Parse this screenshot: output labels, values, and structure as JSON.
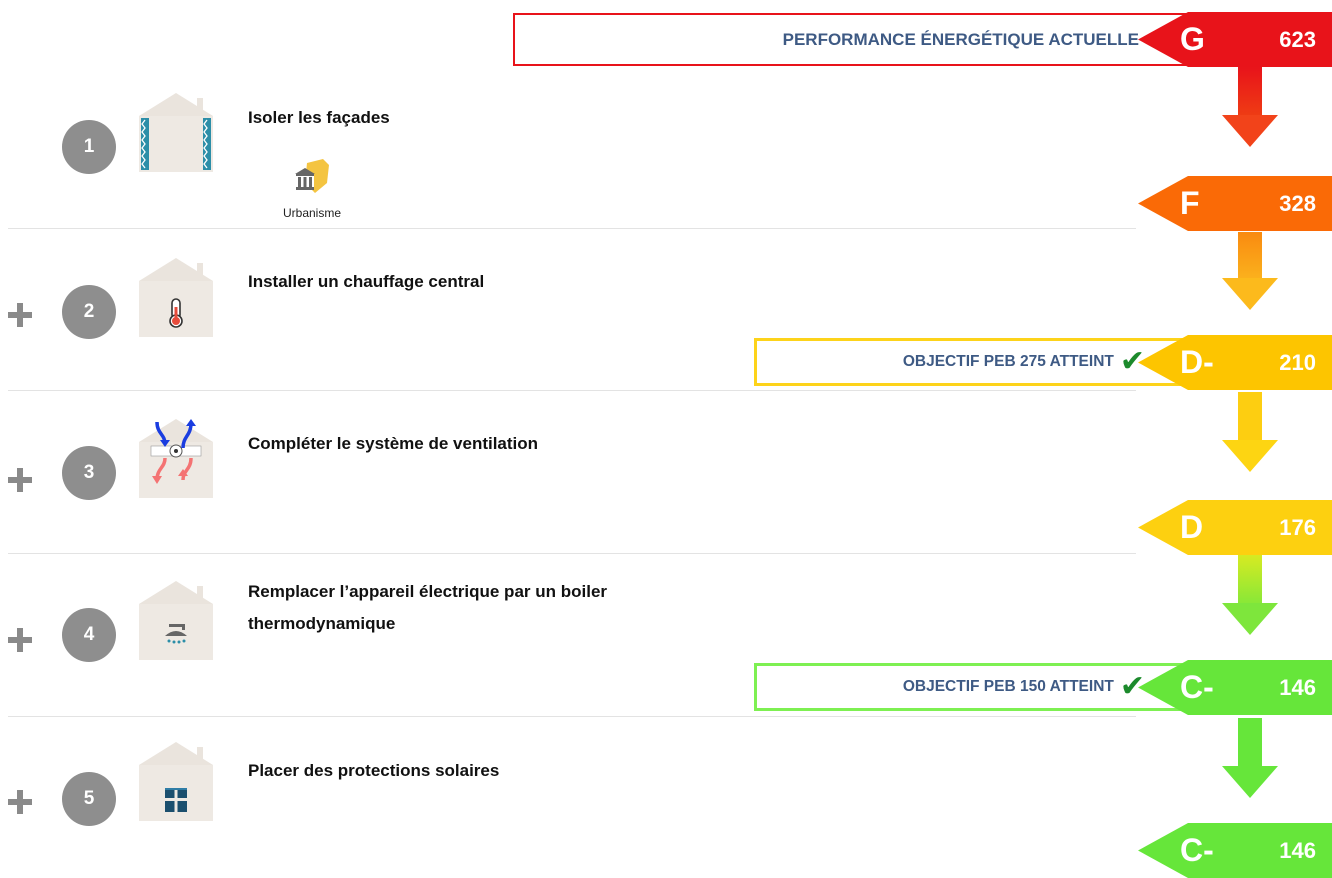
{
  "current": {
    "label": "PERFORMANCE ÉNERGÉTIQUE ACTUELLE",
    "grade": "G",
    "value": "623",
    "color": "#e8131a"
  },
  "steps": [
    {
      "number": "1",
      "show_plus": false,
      "title": "Isoler les façades",
      "icon": "facade-insulation-house-icon",
      "badge": {
        "icon": "urbanisme-building-icon",
        "label": "Urbanisme"
      }
    },
    {
      "number": "2",
      "show_plus": true,
      "title": "Installer un chauffage central",
      "icon": "thermometer-house-icon"
    },
    {
      "number": "3",
      "show_plus": true,
      "title": "Compléter le système de ventilation",
      "icon": "ventilation-house-icon"
    },
    {
      "number": "4",
      "show_plus": true,
      "title": "Remplacer l’appareil électrique par un boiler thermodynamique",
      "icon": "shower-house-icon"
    },
    {
      "number": "5",
      "show_plus": true,
      "title": "Placer des protections solaires",
      "icon": "window-shade-house-icon"
    }
  ],
  "labels": [
    {
      "grade": "G",
      "value": "623",
      "color": "#e8131a"
    },
    {
      "grade": "F",
      "value": "328",
      "color": "#fa6a06"
    },
    {
      "grade": "D-",
      "value": "210",
      "color": "#fdc500"
    },
    {
      "grade": "D",
      "value": "176",
      "color": "#fdd010"
    },
    {
      "grade": "C-",
      "value": "146",
      "color": "#66e63a"
    },
    {
      "grade": "C-",
      "value": "146",
      "color": "#66e63a"
    }
  ],
  "objectives": [
    {
      "text": "OBJECTIF PEB 275 ATTEINT",
      "check": "✔",
      "color": "#fdd31a"
    },
    {
      "text": "OBJECTIF PEB 150 ATTEINT",
      "check": "✔",
      "color": "#7ef052"
    }
  ]
}
